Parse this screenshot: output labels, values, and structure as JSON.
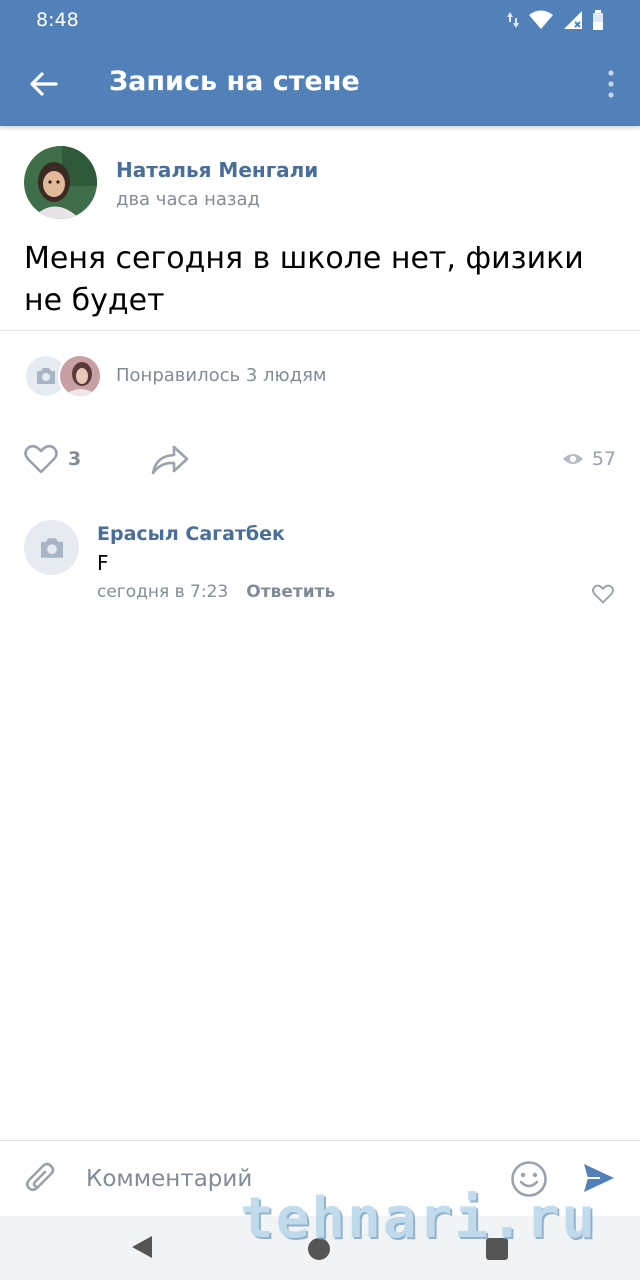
{
  "status_bar": {
    "time": "8:48"
  },
  "app_bar": {
    "title": "Запись на стене"
  },
  "post": {
    "author": "Наталья Менгали",
    "time_ago": "два часа назад",
    "text": "Меня сегодня в школе нет, физики не будет",
    "likes_summary": "Понравилось 3 людям",
    "like_count": "3",
    "view_count": "57"
  },
  "comment": {
    "author": "Ерасыл Сагатбек",
    "text": "F",
    "time": "сегодня в 7:23",
    "reply_label": "Ответить"
  },
  "composer": {
    "placeholder": "Комментарий"
  },
  "watermark": {
    "text": "tehnari.ru"
  },
  "colors": {
    "accent": "#5181b8",
    "name": "#4a6e9a",
    "secondary": "#818c99"
  }
}
